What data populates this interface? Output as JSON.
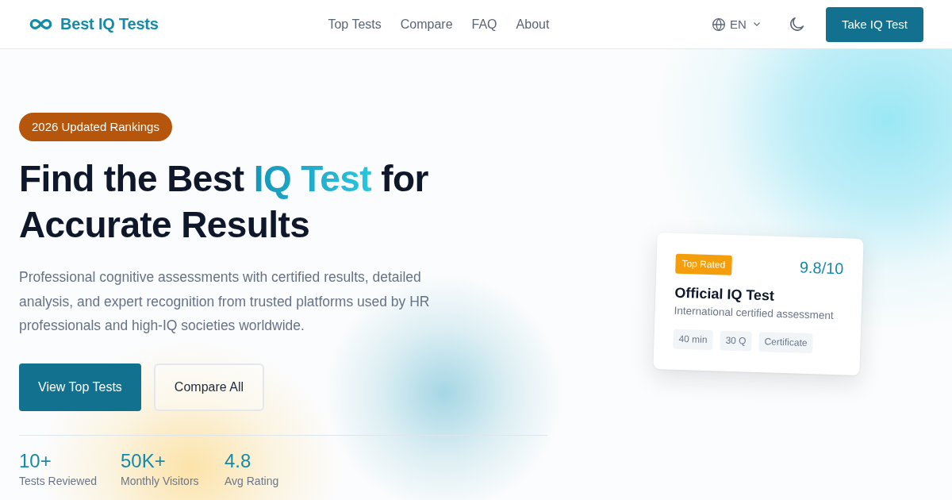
{
  "header": {
    "logo": {
      "text": "Best IQ Tests"
    },
    "nav": [
      {
        "label": "Top Tests"
      },
      {
        "label": "Compare"
      },
      {
        "label": "FAQ"
      },
      {
        "label": "About"
      }
    ],
    "language": {
      "label": "EN"
    },
    "cta": {
      "label": "Take IQ Test"
    }
  },
  "hero": {
    "badge": "2026 Updated Rankings",
    "headline": {
      "before": "Find the Best",
      "highlight": "IQ Test",
      "after": "for Accurate Results"
    },
    "description": "Professional cognitive assessments with certified results, detailed analysis, and expert recognition from trusted platforms used by HR professionals and high-IQ societies worldwide.",
    "buttons": [
      {
        "label": "View Top Tests",
        "kind": "primary"
      },
      {
        "label": "Compare All",
        "kind": "secondary"
      }
    ],
    "stats": [
      {
        "value": "10+",
        "label": "Tests Reviewed"
      },
      {
        "value": "50K+",
        "label": "Monthly Visitors"
      },
      {
        "value": "4.8",
        "label": "Avg Rating"
      }
    ]
  },
  "featured_card": {
    "badge": "Top Rated",
    "score": "9.8/10",
    "title": "Official IQ Test",
    "subtitle": "International certified assessment",
    "tags": [
      "40 min",
      "30 Q",
      "Certificate"
    ]
  }
}
